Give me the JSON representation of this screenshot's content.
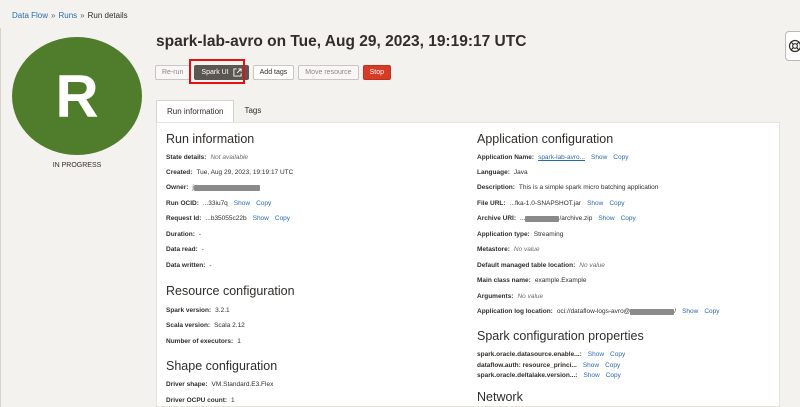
{
  "breadcrumb": {
    "items": [
      "Data Flow",
      "Runs",
      "Run details"
    ]
  },
  "run": {
    "title": "spark-lab-avro on Tue, Aug 29, 2023, 19:19:17 UTC",
    "avatar_letter": "R",
    "status": "IN PROGRESS"
  },
  "actions": {
    "rerun": "Re-run",
    "spark_ui": "Spark UI",
    "add_tags": "Add tags",
    "move_resource": "Move resource",
    "stop": "Stop"
  },
  "tabs": {
    "run_information": "Run information",
    "tags": "Tags"
  },
  "run_information": {
    "heading": "Run information",
    "state_details": {
      "label": "State details:",
      "value": "Not available"
    },
    "created": {
      "label": "Created:",
      "value": "Tue, Aug 29, 2023, 19:19:17 UTC"
    },
    "owner": {
      "label": "Owner:",
      "value": "j"
    },
    "run_ocid": {
      "label": "Run OCID:",
      "value": "...33iu7q"
    },
    "request_id": {
      "label": "Request Id:",
      "value": "...b35055c22b"
    },
    "duration": {
      "label": "Duration:",
      "value": "-"
    },
    "data_read": {
      "label": "Data read:",
      "value": "-"
    },
    "data_written": {
      "label": "Data written:",
      "value": "-"
    }
  },
  "resource_configuration": {
    "heading": "Resource configuration",
    "spark_version": {
      "label": "Spark version:",
      "value": "3.2.1"
    },
    "scala_version": {
      "label": "Scala version:",
      "value": "Scala 2.12"
    },
    "executors": {
      "label": "Number of executors:",
      "value": "1"
    }
  },
  "shape_configuration": {
    "heading": "Shape configuration",
    "driver_shape": {
      "label": "Driver shape:",
      "value": "VM.Standard.E3.Flex"
    },
    "driver_ocpu": {
      "label": "Driver OCPU count:",
      "value": "1"
    }
  },
  "application_configuration": {
    "heading": "Application configuration",
    "app_name": {
      "label": "Application Name:",
      "value": "spark-lab-avro..."
    },
    "language": {
      "label": "Language:",
      "value": "Java"
    },
    "description": {
      "label": "Description:",
      "value": "This is a simple spark micro batching application"
    },
    "file_url": {
      "label": "File URL:",
      "value": "...fka-1.0-SNAPSHOT.jar"
    },
    "archive_uri": {
      "label": "Archive URI:",
      "prefix": "...",
      "suffix": "/archive.zip"
    },
    "app_type": {
      "label": "Application type:",
      "value": "Streaming"
    },
    "metastore": {
      "label": "Metastore:",
      "value": "No value"
    },
    "default_table_location": {
      "label": "Default managed table location:",
      "value": "No value"
    },
    "main_class": {
      "label": "Main class name:",
      "value": "example.Example"
    },
    "arguments": {
      "label": "Arguments:",
      "value": "No value"
    },
    "log_location": {
      "label": "Application log location:",
      "prefix": "oci://dataflow-logs-avro@",
      "suffix": "/"
    }
  },
  "spark_properties": {
    "heading": "Spark configuration properties",
    "items": [
      "spark.oracle.datasource.enable...:",
      "dataflow.auth: resource_princi...",
      "spark.oracle.deltalake.version...:"
    ]
  },
  "network": {
    "heading": "Network"
  },
  "links": {
    "show": "Show",
    "copy": "Copy"
  },
  "icons": {
    "external_link": "external-link-icon",
    "help": "help-widget-icon"
  },
  "colors": {
    "avatar": "#4f7d2c",
    "stop": "#d63b25",
    "link": "#2a6bb0",
    "highlight": "#e31212"
  }
}
